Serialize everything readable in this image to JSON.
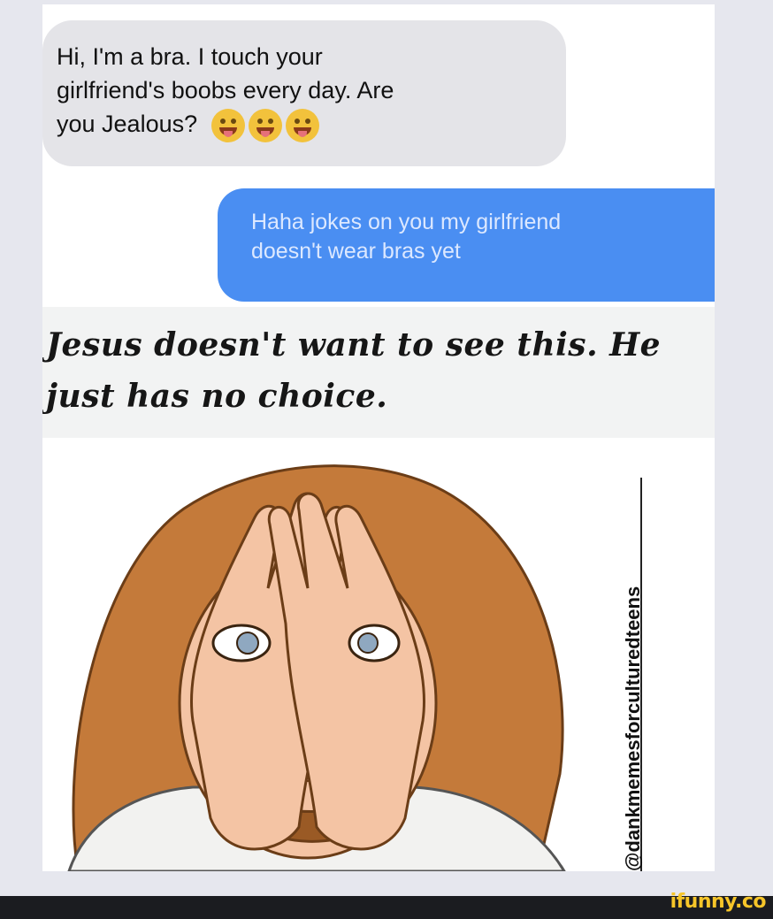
{
  "messages": {
    "incoming": {
      "line1": "Hi, I'm a bra. I touch your",
      "line2": "girlfriend's boobs every day. Are",
      "line3": "you Jealous?"
    },
    "outgoing": {
      "line1": "Haha jokes on you my girlfriend",
      "line2": "doesn't wear bras yet"
    }
  },
  "caption": {
    "line1": "Jesus doesn't want to see this. He",
    "line2": "just has no choice."
  },
  "emojis": [
    "tongue-face-emoji",
    "tongue-face-emoji",
    "squint-tongue-face-emoji"
  ],
  "watermark": "@dankmemesforculturedteens",
  "footer": {
    "brand": "ifunny.co"
  },
  "colors": {
    "incoming_bubble": "#e4e4e8",
    "outgoing_bubble": "#4a8ef2",
    "brand": "#f6c529"
  }
}
